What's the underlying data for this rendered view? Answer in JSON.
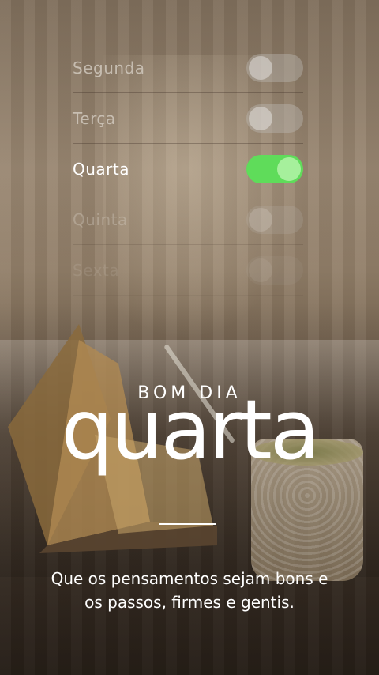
{
  "days": [
    {
      "label": "Segunda",
      "enabled": false,
      "label_color": "#d9d2c8",
      "opacity": 0.75
    },
    {
      "label": "Terça",
      "enabled": false,
      "label_color": "#d9d2c8",
      "opacity": 0.75
    },
    {
      "label": "Quarta",
      "enabled": true,
      "label_color": "#ffffff",
      "opacity": 1
    },
    {
      "label": "Quinta",
      "enabled": false,
      "label_color": "#d9d2c8",
      "opacity": 0.35
    },
    {
      "label": "Sexta",
      "enabled": false,
      "label_color": "#d9d2c8",
      "opacity": 0.15
    }
  ],
  "greeting": {
    "small": "BOM DIA",
    "big": "quarta"
  },
  "quote": "Que os pensamentos sejam bons e os passos, firmes e gentis.",
  "colors": {
    "toggle_on": "#5fdc5a",
    "text": "#ffffff"
  }
}
